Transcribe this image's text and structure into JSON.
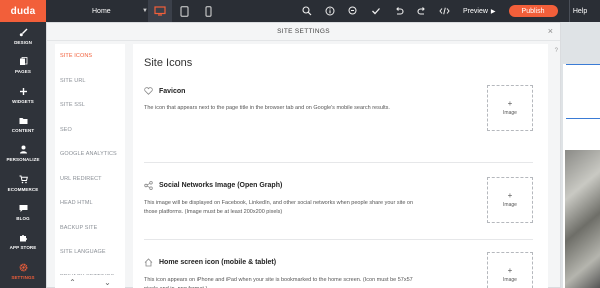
{
  "topbar": {
    "logo": "duda",
    "page_select": "Home",
    "preview": "Preview",
    "publish": "Publish",
    "help": "Help"
  },
  "sidebar": {
    "items": [
      {
        "label": "DESIGN",
        "icon": "paintbrush-icon"
      },
      {
        "label": "PAGES",
        "icon": "pages-icon"
      },
      {
        "label": "WIDGETS",
        "icon": "plus-icon"
      },
      {
        "label": "CONTENT",
        "icon": "folder-icon"
      },
      {
        "label": "PERSONALIZE",
        "icon": "person-icon"
      },
      {
        "label": "ECOMMERCE",
        "icon": "cart-icon"
      },
      {
        "label": "BLOG",
        "icon": "chat-icon"
      },
      {
        "label": "APP STORE",
        "icon": "puzzle-icon"
      },
      {
        "label": "SETTINGS",
        "icon": "gear-icon",
        "active": true
      }
    ]
  },
  "modal": {
    "title": "SITE SETTINGS",
    "close": "×"
  },
  "nav": {
    "items": [
      {
        "label": "SITE ICONS",
        "active": true
      },
      {
        "label": "SITE URL"
      },
      {
        "label": "SITE SSL"
      },
      {
        "label": "SEO"
      },
      {
        "label": "GOOGLE ANALYTICS"
      },
      {
        "label": "URL REDIRECT"
      },
      {
        "label": "HEAD HTML"
      },
      {
        "label": "BACKUP SITE"
      },
      {
        "label": "SITE LANGUAGE"
      },
      {
        "label": "PRIVACY SETTINGS"
      }
    ],
    "up": "⌃",
    "down": "⌄"
  },
  "content": {
    "title": "Site Icons",
    "help": "?",
    "sections": [
      {
        "icon": "heart-icon",
        "title": "Favicon",
        "desc": "The icon that appears next to the page title in the browser tab and on Google's mobile search results.",
        "image_plus": "+",
        "image_label": "Image"
      },
      {
        "icon": "share-icon",
        "title": "Social Networks Image (Open Graph)",
        "desc": "This image will be displayed on Facebook, LinkedIn, and other social networks when people share your site on those platforms. (Image must be at least 200x200 pixels)",
        "image_plus": "+",
        "image_label": "Image"
      },
      {
        "icon": "home-icon",
        "title": "Home screen icon (mobile & tablet)",
        "desc": "This icon appears on iPhone and iPad when your site is bookmarked to the home screen. (Icon must be 57x57 pixels and in .png format.)",
        "image_plus": "+",
        "image_label": "Image"
      }
    ]
  },
  "colors": {
    "accent": "#f25f3a",
    "topbar": "#2a2e35",
    "sidebar": "#2f333a"
  }
}
